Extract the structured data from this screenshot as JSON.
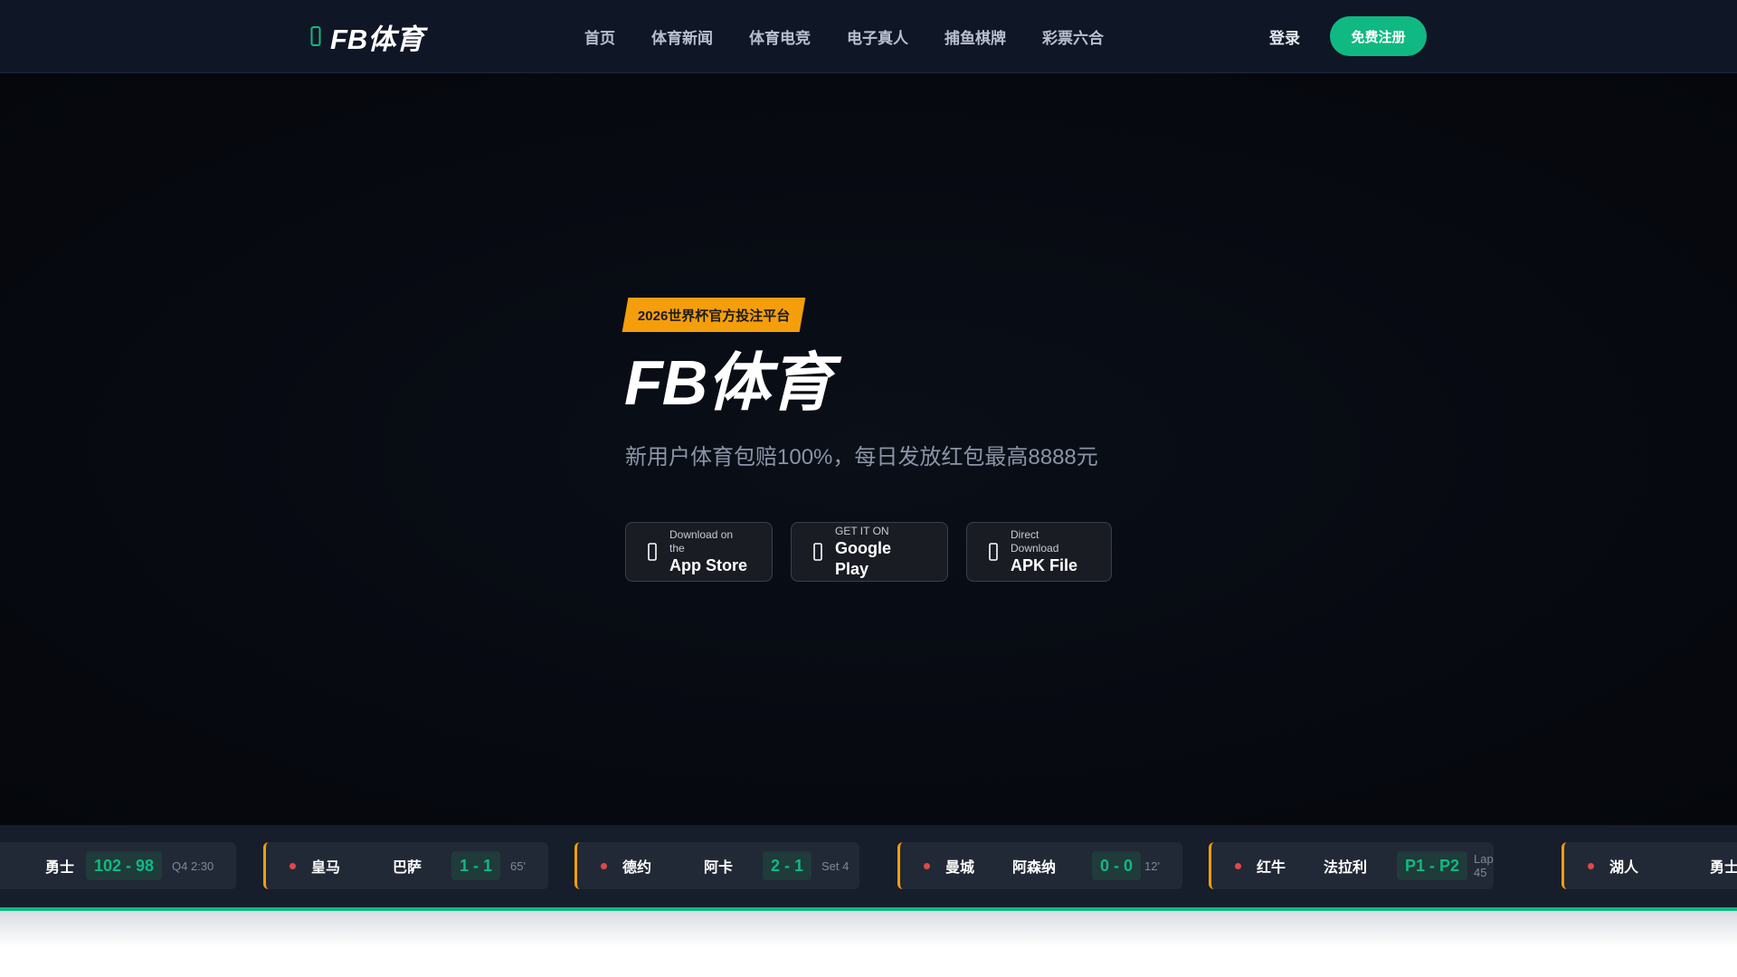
{
  "header": {
    "logo_text": "FB体育",
    "nav": [
      "首页",
      "体育新闻",
      "体育电竞",
      "电子真人",
      "捕鱼棋牌",
      "彩票六合"
    ],
    "login_label": "登录",
    "register_label": "免费注册"
  },
  "hero": {
    "badge": "2026世界杯官方投注平台",
    "title": "FB体育",
    "subtitle": "新用户体育包赔100%，每日发放红包最高8888元",
    "downloads": [
      {
        "small": "Download on the",
        "big": "App Store",
        "icon": "apple-icon"
      },
      {
        "small": "GET IT ON",
        "big": "Google Play",
        "icon": "google-play-icon"
      },
      {
        "small": "Direct Download",
        "big": "APK File",
        "icon": "android-icon"
      }
    ]
  },
  "ticker": {
    "matches": [
      {
        "team_a": "",
        "team_b": "勇士",
        "score": "102 - 98",
        "status": "Q4 2:30"
      },
      {
        "team_a": "皇马",
        "team_b": "巴萨",
        "score": "1 - 1",
        "status": "65'"
      },
      {
        "team_a": "德约",
        "team_b": "阿卡",
        "score": "2 - 1",
        "status": "Set 4"
      },
      {
        "team_a": "曼城",
        "team_b": "阿森纳",
        "score": "0 - 0",
        "status": "12'"
      },
      {
        "team_a": "红牛",
        "team_b": "法拉利",
        "score": "P1 - P2",
        "status": "Lap 45"
      },
      {
        "team_a": "湖人",
        "team_b": "勇士",
        "score": "",
        "status": ""
      }
    ]
  },
  "colors": {
    "brand_green": "#10b981",
    "badge_orange": "#f59e0b",
    "header_bg": "#0f1626",
    "live_dot": "#e04848"
  }
}
